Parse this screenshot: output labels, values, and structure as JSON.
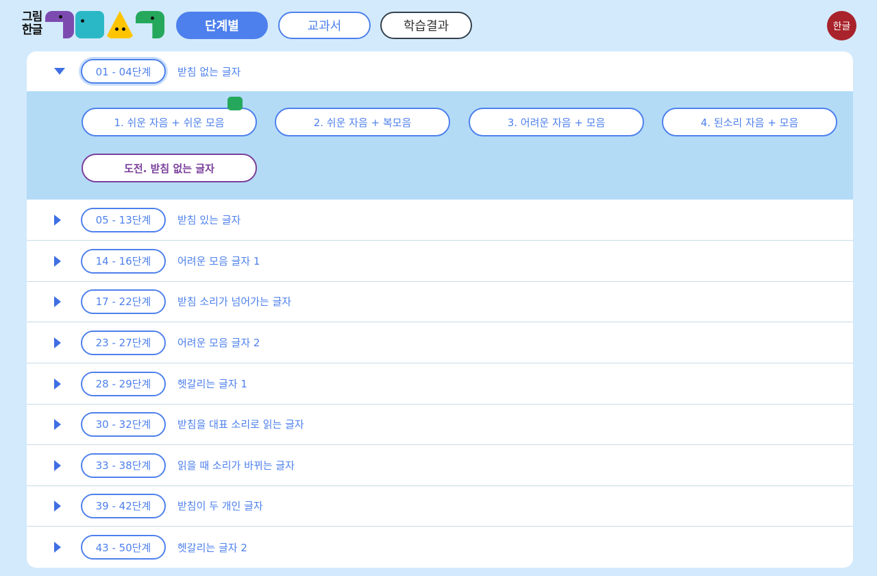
{
  "logo": {
    "text_line1": "그림",
    "text_line2": "한글"
  },
  "nav": {
    "stage": "단계별",
    "textbook": "교과서",
    "results": "학습결과"
  },
  "lang": "한글",
  "colors": {
    "accent": "#4d80ec",
    "challenge": "#7a3e9a",
    "lang_bg": "#a8232b",
    "expanded_bg": "#b3dbf6"
  },
  "stages": [
    {
      "range": "01 - 04단계",
      "desc": "받침 없는 글자",
      "expanded": true
    },
    {
      "range": "05 - 13단계",
      "desc": "받침 있는 글자"
    },
    {
      "range": "14 - 16단계",
      "desc": "어려운 모음 글자 1"
    },
    {
      "range": "17 - 22단계",
      "desc": "받침 소리가 넘어가는 글자"
    },
    {
      "range": "23 - 27단계",
      "desc": "어려운 모음 글자 2"
    },
    {
      "range": "28 - 29단계",
      "desc": "헷갈리는 글자 1"
    },
    {
      "range": "30 - 32단계",
      "desc": "받침을 대표 소리로 읽는 글자"
    },
    {
      "range": "33 - 38단계",
      "desc": "읽을 때 소리가 바뀌는 글자"
    },
    {
      "range": "39 - 42단계",
      "desc": "받침이 두 개인 글자"
    },
    {
      "range": "43 - 50단계",
      "desc": "헷갈리는 글자 2"
    }
  ],
  "sub_items": [
    "1. 쉬운 자음 + 쉬운 모음",
    "2. 쉬운 자음 + 복모음",
    "3. 어려운 자음 + 모음",
    "4. 된소리 자음 + 모음"
  ],
  "challenge": "도전. 받침 없는 글자"
}
